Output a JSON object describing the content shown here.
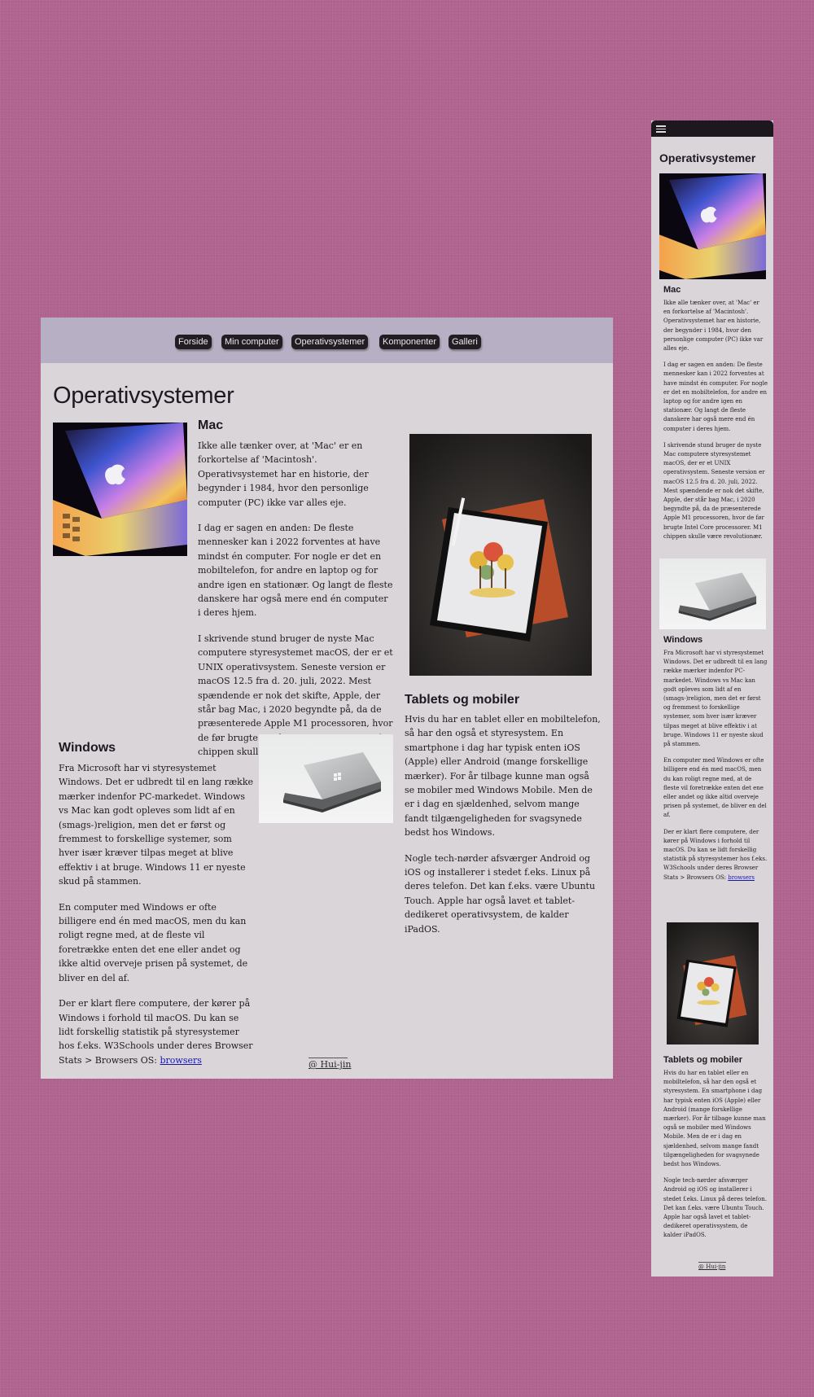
{
  "nav": {
    "items": [
      "Forside",
      "Min computer",
      "Operativsystemer",
      "Komponenter",
      "Galleri"
    ]
  },
  "page": {
    "title": "Operativsystemer",
    "mac": {
      "heading": "Mac",
      "paragraphs": [
        "Ikke alle tænker over, at 'Mac' er en forkortelse af 'Macintosh'. Operativsystemet har en historie, der begynder i 1984, hvor den personlige computer (PC) ikke var alles eje.",
        "I dag er sagen en anden: De fleste mennesker kan i 2022 forventes at have mindst én computer. For nogle er det en mobiltelefon, for andre en laptop og for andre igen en stationær. Og langt de fleste danskere har også mere end én computer i deres hjem.",
        "I skrivende stund bruger de nyste Mac computere styresystemet macOS, der er et UNIX operativsystem. Seneste version er macOS 12.5 fra d. 20. juli, 2022. Mest spændende er nok det skifte, Apple, der står bag Mac, i 2020 begyndte på, da de præsenterede Apple M1 processoren, hvor de før brugte Intel Core processorer. M1 chippen skulle være revolutionær."
      ]
    },
    "windows": {
      "heading": "Windows",
      "paragraphs": [
        "Fra Microsoft har vi styresystemet Windows. Det er udbredt til en lang række mærker indenfor PC-markedet. Windows vs Mac kan godt opleves som lidt af en (smags-)religion, men det er først og fremmest to forskellige systemer, som hver især kræver tilpas meget at blive effektiv i at bruge. Windows 11 er nyeste skud på stammen.",
        "En computer med Windows er ofte billigere end én med macOS, men du kan roligt regne med, at de fleste vil foretrække enten det ene eller andet og ikke altid overveje prisen på systemet, de bliver en del af.",
        "Der er klart flere computere, der kører på Windows i forhold til macOS. Du kan se lidt forskellig statistik på styresystemer hos f.eks. W3Schools under deres Browser Stats > Browsers OS: "
      ],
      "link_text": "browsers"
    },
    "tablets": {
      "heading": "Tablets og mobiler",
      "paragraphs": [
        "Hvis du har en tablet eller en mobiltelefon, så har den også et styresystem. En smartphone i dag har typisk enten iOS (Apple) eller Android (mange forskellige mærker). For år tilbage kunne man også se mobiler med Windows Mobile. Men de er i dag en sjældenhed, selvom mange fandt tilgængeligheden for svagsynede bedst hos Windows.",
        "Nogle tech-nørder afsværger Android og iOS og installerer i stedet f.eks. Linux på deres telefon. Det kan f.eks. være Ubuntu Touch. Apple har også lavet et tablet-dedikeret operativsystem, de kalder iPadOS."
      ]
    },
    "footer": "@ Hui-jin"
  },
  "colors": {
    "background": "#b0648f",
    "panel": "#dad5d8",
    "nav_bar": "#b7b0c4",
    "button": "#221d22",
    "link": "#1616b8"
  },
  "icons": [
    "hamburger-menu-icon"
  ]
}
